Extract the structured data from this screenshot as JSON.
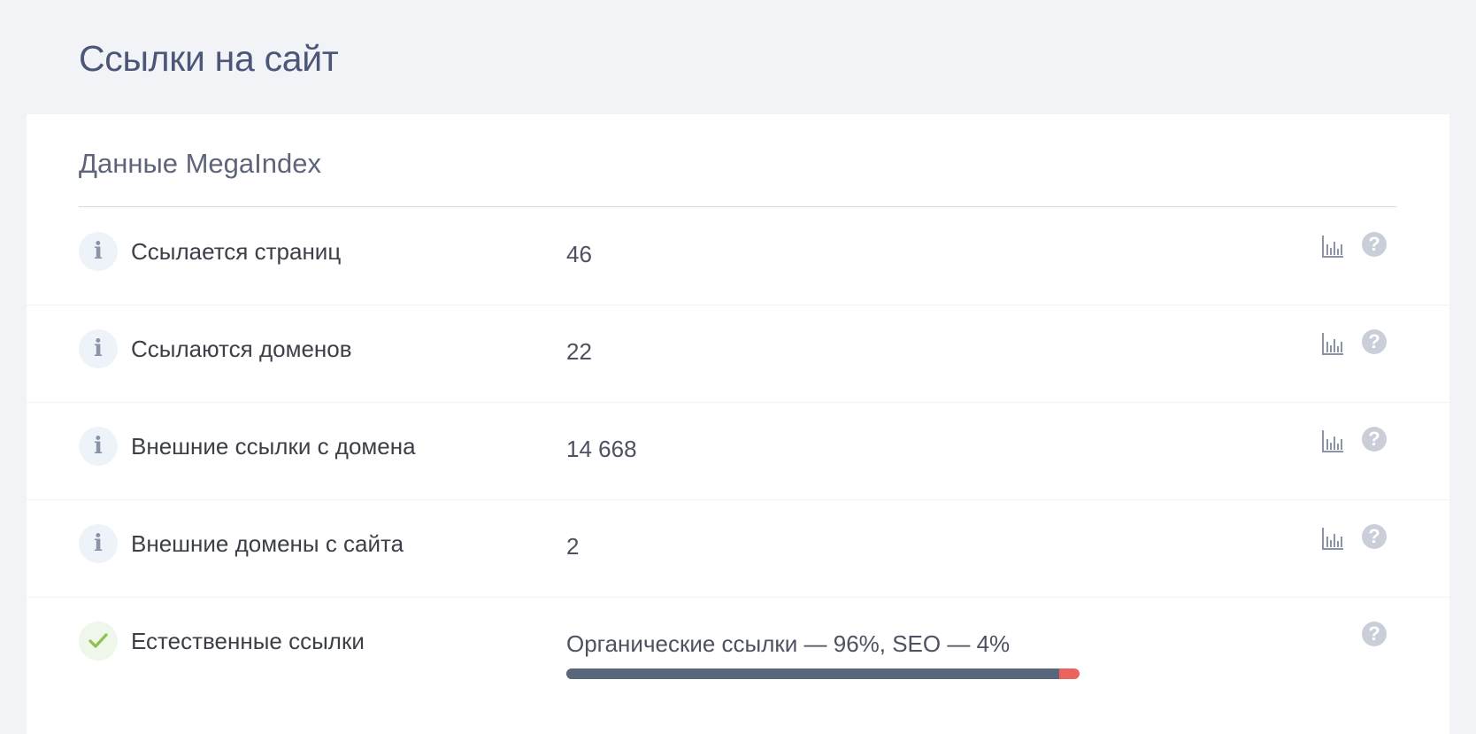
{
  "page": {
    "title": "Ссылки на сайт"
  },
  "card": {
    "title": "Данные MegaIndex"
  },
  "rows": [
    {
      "label": "Ссылается страниц",
      "value": "46",
      "status": "info"
    },
    {
      "label": "Ссылаются доменов",
      "value": "22",
      "status": "info"
    },
    {
      "label": "Внешние ссылки с домена",
      "value": "14 668",
      "status": "info"
    },
    {
      "label": "Внешние домены с сайта",
      "value": "2",
      "status": "info"
    },
    {
      "label": "Естественные ссылки",
      "value": "Органические ссылки — 96%, SEO — 4%",
      "status": "ok"
    }
  ],
  "icons": {
    "info": "info-icon",
    "ok": "check-icon",
    "chart": "bar-chart-icon",
    "help": "help-icon",
    "info_glyph": "i",
    "help_glyph": "?"
  },
  "link_ratio": {
    "organic_percent": 96,
    "seo_percent": 4
  },
  "colors": {
    "organic": "#58677b",
    "seo": "#eb625e",
    "ok": "#8cc152",
    "icon": "#8b93a8"
  }
}
